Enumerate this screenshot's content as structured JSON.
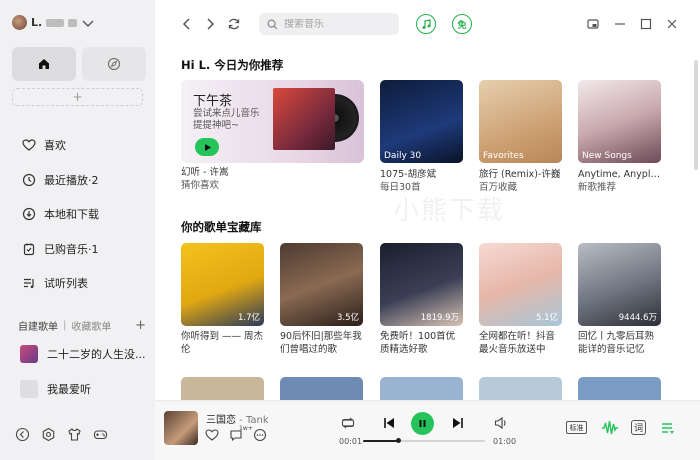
{
  "user": {
    "name": "L."
  },
  "sidebar": {
    "menu": [
      {
        "label": "喜欢",
        "icon": "heart-icon"
      },
      {
        "label": "最近播放·2",
        "icon": "clock-icon"
      },
      {
        "label": "本地和下载",
        "icon": "download-icon"
      },
      {
        "label": "已购音乐·1",
        "icon": "purchased-icon"
      },
      {
        "label": "试听列表",
        "icon": "list-icon"
      }
    ],
    "playlist_tabs": {
      "created": "自建歌单",
      "separator": "|",
      "collected": "收藏歌单"
    },
    "playlists": [
      {
        "label": "二十二岁的人生没..."
      },
      {
        "label": "我最爱听"
      }
    ]
  },
  "search": {
    "placeholder": "搜索音乐"
  },
  "topbar": {
    "free_badge": "免"
  },
  "recommend": {
    "title": "Hi L. 今日为你推荐",
    "banner": {
      "title": "下午茶",
      "subtitle": "尝试来点儿音乐提提神吧~",
      "caption1": "幻听 - 许嵩",
      "caption2": "猜你喜欢"
    },
    "cards": [
      {
        "tag": "Daily 30",
        "line1": "1075-胡彦斌",
        "line2": "每日30首"
      },
      {
        "tag": "Favorites",
        "line1": "旅行 (Remix)-许巍",
        "line2": "百万收藏"
      },
      {
        "tag": "New Songs",
        "line1": "Anytime, Anyplace...",
        "line2": "新歌推荐"
      }
    ]
  },
  "library": {
    "title": "你的歌单宝藏库",
    "cards": [
      {
        "count": "1.7亿",
        "desc": "你听得到 —— 周杰伦"
      },
      {
        "count": "3.5亿",
        "desc": "90后怀旧|那些年我们曾唱过的歌"
      },
      {
        "count": "1819.9万",
        "desc": "免费听！100首优质精选好歌"
      },
      {
        "count": "5.1亿",
        "desc": "全网都在听！抖音最火音乐放送中"
      },
      {
        "count": "9444.6万",
        "desc": "回忆丨九零后耳熟能详的音乐记忆"
      }
    ]
  },
  "watermark": "小熊下载",
  "player": {
    "title": "三国恋",
    "artist": " - Tank",
    "comment_count": "1w+",
    "current_time": "00:01",
    "total_time": "01:00",
    "progress": 0.29,
    "quality": "标准",
    "lyric": "词"
  },
  "colors": {
    "accent": "#25c35a",
    "sidebar_bg": "#f1f1f3"
  }
}
